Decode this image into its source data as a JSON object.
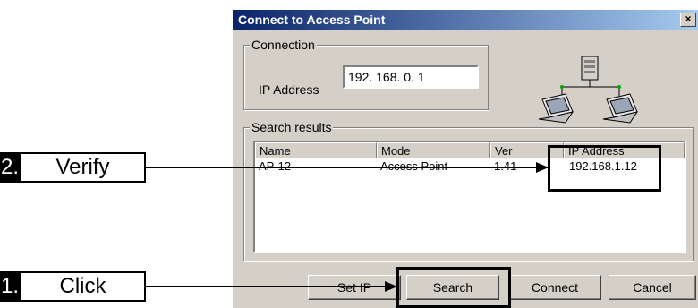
{
  "dialog": {
    "title": "Connect to Access Point",
    "close_label": "×",
    "connection": {
      "group_label": "Connection",
      "ip_label": "IP Address",
      "ip_value": "192. 168.   0.   1"
    },
    "search_results": {
      "group_label": "Search results",
      "columns": [
        "Name",
        "Mode",
        "Ver",
        "IP Address"
      ],
      "rows": [
        {
          "name": "AP-12",
          "mode": "Access Point",
          "ver": "1.41",
          "ip": "192.168.1.12"
        }
      ]
    },
    "buttons": {
      "set_ip": "Set IP",
      "search": "Search",
      "connect": "Connect",
      "cancel": "Cancel"
    },
    "icons": [
      "network-server-icon",
      "laptop-icon",
      "laptop-icon"
    ]
  },
  "callouts": [
    {
      "number": "2.",
      "label": "Verify"
    },
    {
      "number": "1.",
      "label": "Click"
    }
  ]
}
